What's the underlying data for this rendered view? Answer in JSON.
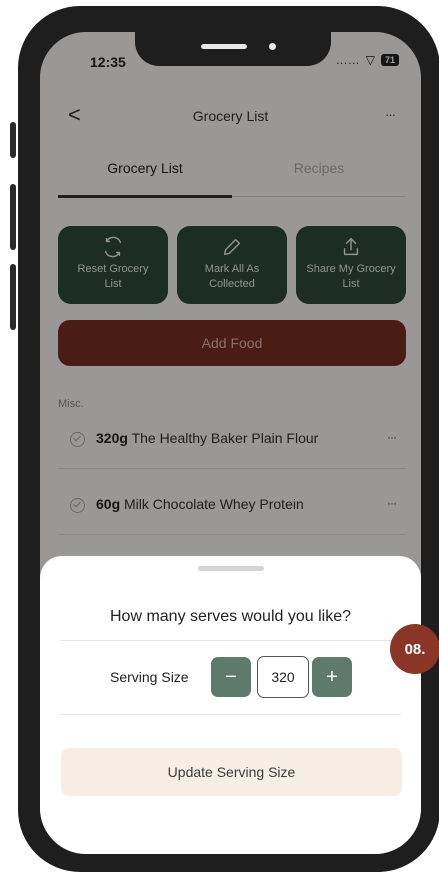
{
  "status_bar": {
    "time": "12:35",
    "signal": "……",
    "wifi": "▽",
    "battery": "71"
  },
  "nav": {
    "back_glyph": "<",
    "title": "Grocery List",
    "more_glyph": "···"
  },
  "tabs": [
    {
      "label": "Grocery List",
      "active": true
    },
    {
      "label": "Recipes",
      "active": false
    }
  ],
  "actions": [
    {
      "icon": "refresh-icon",
      "label": "Reset Grocery List"
    },
    {
      "icon": "pencil-icon",
      "label": "Mark All As Collected"
    },
    {
      "icon": "share-icon",
      "label": "Share My Grocery List"
    }
  ],
  "add_food_label": "Add Food",
  "section_label": "Misc.",
  "items": [
    {
      "qty": "320g",
      "name": "The Healthy Baker Plain Flour",
      "more": "···"
    },
    {
      "qty": "60g",
      "name": "Milk Chocolate Whey Protein",
      "more": "···"
    }
  ],
  "sheet": {
    "question": "How many serves would you like?",
    "serving_label": "Serving Size",
    "minus": "−",
    "value": "320",
    "plus": "+",
    "update_label": "Update Serving Size"
  },
  "step_badge": "08.",
  "colors": {
    "primary_green": "#2e4a3c",
    "stepper_green": "#5e7a6c",
    "brand_red": "#7a2d22",
    "badge_red": "#8a3526",
    "cream": "#f7efe3"
  }
}
